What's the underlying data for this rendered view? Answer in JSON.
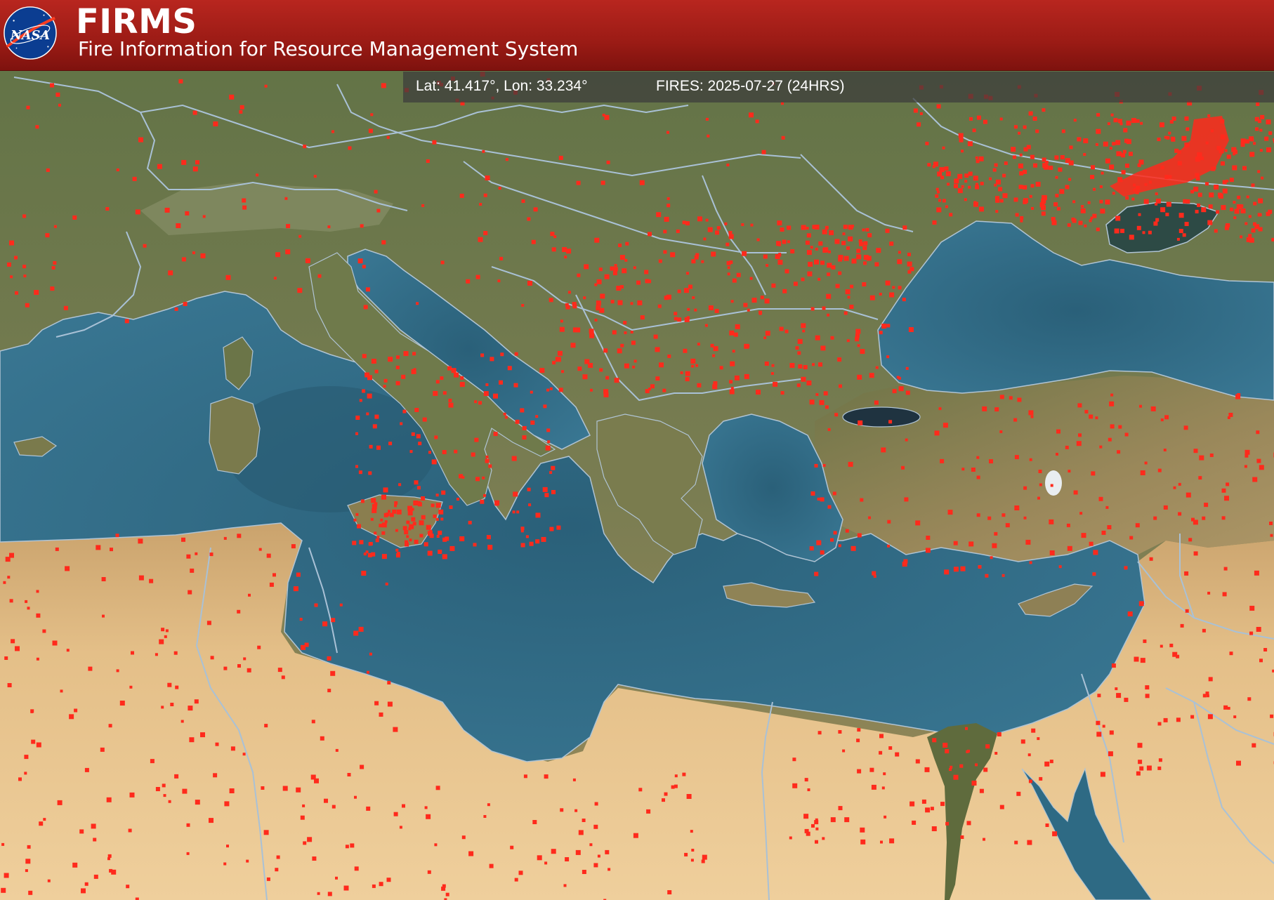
{
  "header": {
    "logo_text": "NASA",
    "title": "FIRMS",
    "subtitle": "Fire Information for Resource Management System"
  },
  "info_bar": {
    "coordinates": "Lat: 41.417°, Lon: 33.234°",
    "fires": "FIRES: 2025-07-27 (24HRS)"
  },
  "map": {
    "basemap": "satellite imagery",
    "fire_marker_color": "#ff2a1c",
    "border_color": "#a9c1d6",
    "sea_color": "#2e6a84",
    "desert_color": "#e3bd86",
    "vegetation_color": "#6b7a4c"
  }
}
